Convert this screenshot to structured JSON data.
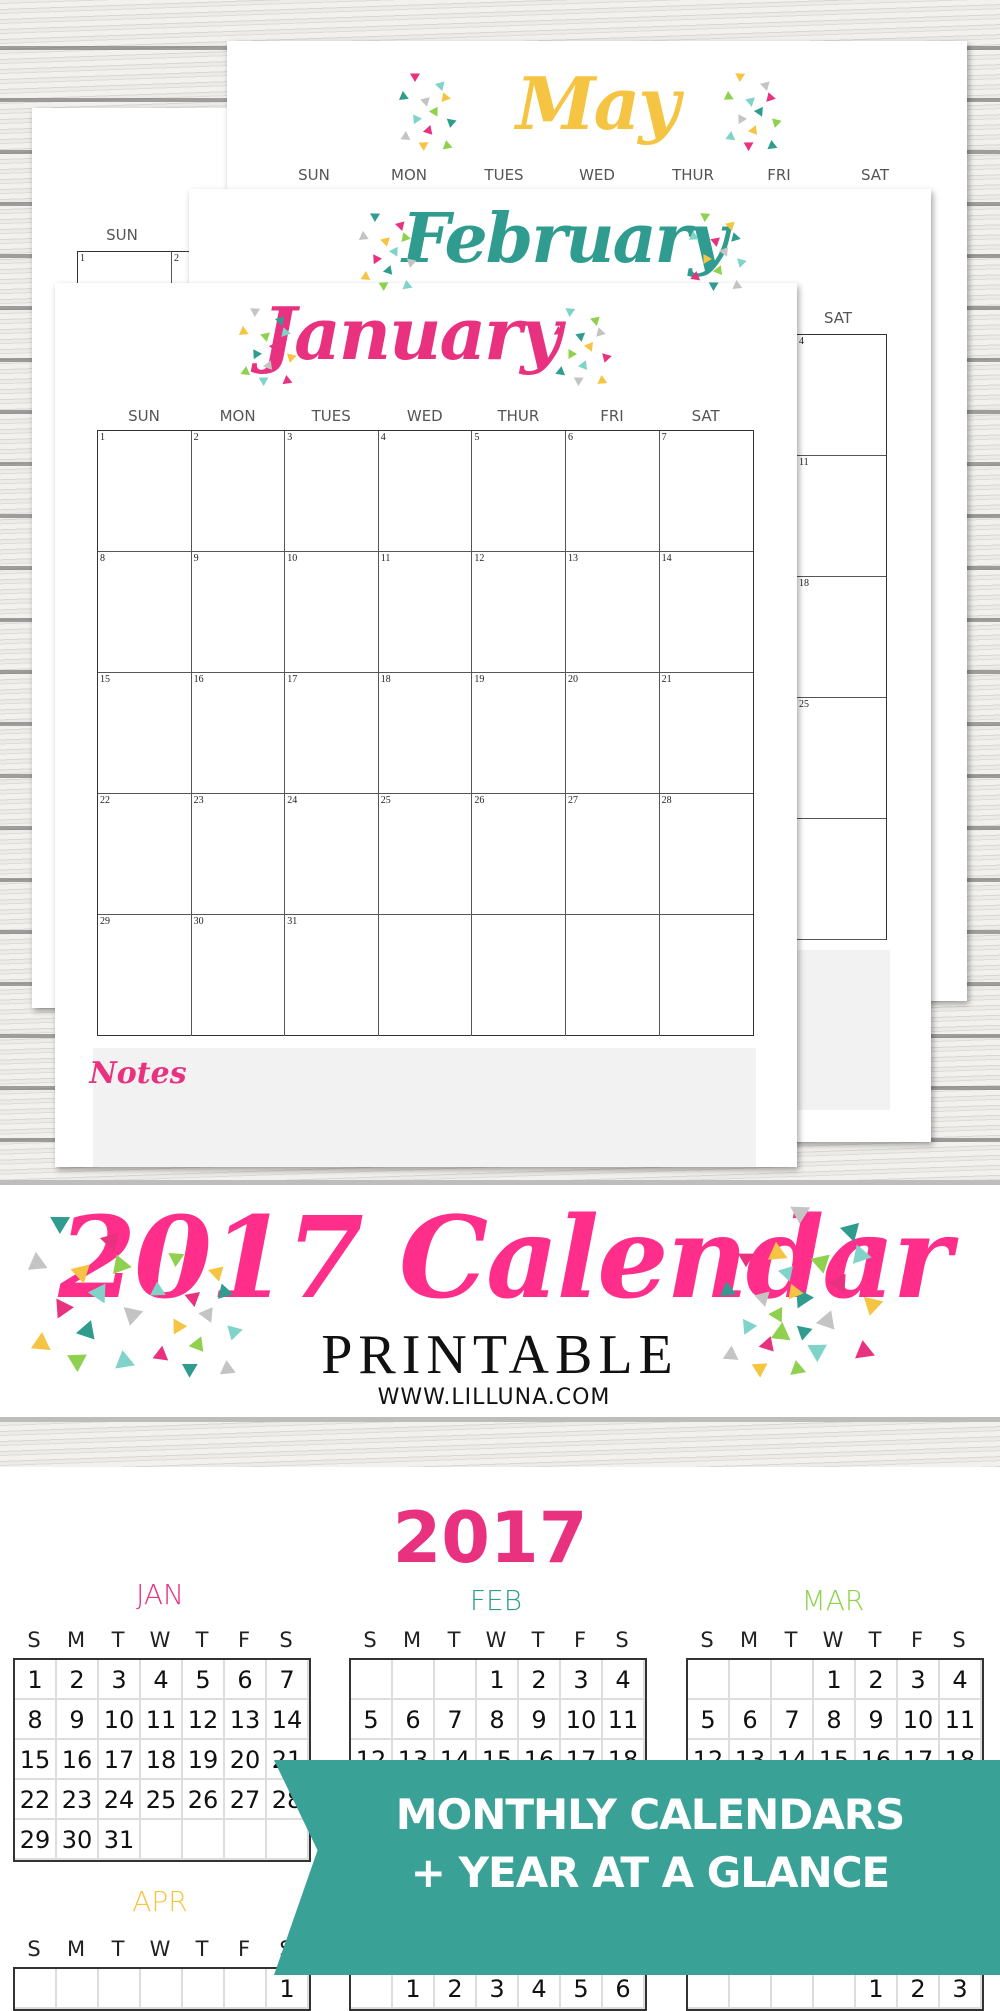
{
  "colors": {
    "pink": "#e8317f",
    "hot_pink": "#ff2e8a",
    "teal": "#2f9c8f",
    "ribbon": "#3aa197",
    "green": "#8fd14f",
    "yellow": "#f6c443",
    "gray": "#c4c4c4",
    "light_teal": "#7fd3c8"
  },
  "may_page": {
    "title": "May",
    "day_headers": [
      "SUN",
      "MON",
      "TUES",
      "WED",
      "THUR",
      "FRI",
      "SAT"
    ]
  },
  "back_page": {
    "day_header": "SUN",
    "dates": [
      "1",
      "2"
    ]
  },
  "feb_page": {
    "title": "February",
    "day_header": "SAT",
    "sat_dates": [
      "4",
      "11",
      "18",
      "25",
      ""
    ]
  },
  "jan_page": {
    "title": "January",
    "day_headers": [
      "SUN",
      "MON",
      "TUES",
      "WED",
      "THUR",
      "FRI",
      "SAT"
    ],
    "weeks": [
      [
        "1",
        "2",
        "3",
        "4",
        "5",
        "6",
        "7"
      ],
      [
        "8",
        "9",
        "10",
        "11",
        "12",
        "13",
        "14"
      ],
      [
        "15",
        "16",
        "17",
        "18",
        "19",
        "20",
        "21"
      ],
      [
        "22",
        "23",
        "24",
        "25",
        "26",
        "27",
        "28"
      ],
      [
        "29",
        "30",
        "31",
        "",
        "",
        "",
        ""
      ]
    ],
    "notes_label": "Notes"
  },
  "banner": {
    "title": "2017 Calendar",
    "subtitle": "PRINTABLE",
    "website": "WWW.LILLUNA.COM"
  },
  "year_glance": {
    "year": "2017",
    "weekday_letters": [
      "S",
      "M",
      "T",
      "W",
      "T",
      "F",
      "S"
    ],
    "months": [
      {
        "label": "JAN",
        "color": "#e8317f",
        "weeks": [
          [
            "1",
            "2",
            "3",
            "4",
            "5",
            "6",
            "7"
          ],
          [
            "8",
            "9",
            "10",
            "11",
            "12",
            "13",
            "14"
          ],
          [
            "15",
            "16",
            "17",
            "18",
            "19",
            "20",
            "21"
          ],
          [
            "22",
            "23",
            "24",
            "25",
            "26",
            "27",
            "28"
          ],
          [
            "29",
            "30",
            "31",
            "",
            "",
            "",
            ""
          ]
        ]
      },
      {
        "label": "FEB",
        "color": "#2f9c8f",
        "weeks": [
          [
            "",
            "",
            "",
            "1",
            "2",
            "3",
            "4"
          ],
          [
            "5",
            "6",
            "7",
            "8",
            "9",
            "10",
            "11"
          ],
          [
            "12",
            "13",
            "14",
            "15",
            "16",
            "17",
            "18"
          ]
        ]
      },
      {
        "label": "MAR",
        "color": "#8fd14f",
        "weeks": [
          [
            "",
            "",
            "",
            "1",
            "2",
            "3",
            "4"
          ],
          [
            "5",
            "6",
            "7",
            "8",
            "9",
            "10",
            "11"
          ],
          [
            "12",
            "13",
            "14",
            "15",
            "16",
            "17",
            "18"
          ]
        ]
      },
      {
        "label": "APR",
        "color": "#f6c443",
        "weeks": [
          [
            "",
            "",
            "",
            "",
            "",
            "",
            "1"
          ]
        ]
      },
      {
        "label": "",
        "color": "#e8317f",
        "weeks": [
          [
            "",
            "1",
            "2",
            "3",
            "4",
            "5",
            "6"
          ]
        ]
      },
      {
        "label": "",
        "color": "#e8317f",
        "weeks": [
          [
            "",
            "",
            "",
            "",
            "1",
            "2",
            "3"
          ]
        ]
      }
    ]
  },
  "ribbon": {
    "line1": "MONTHLY CALENDARS",
    "line2": "+ YEAR AT A GLANCE"
  }
}
